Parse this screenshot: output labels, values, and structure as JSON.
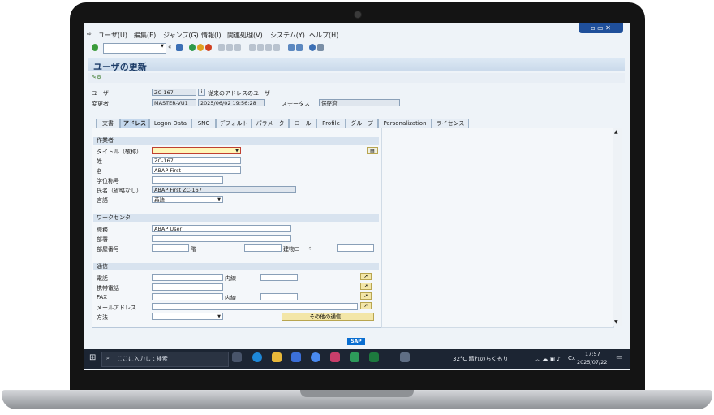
{
  "menu": [
    "ユーザ(U)",
    "編集(E)",
    "ジャンプ(G)",
    "情報(I)",
    "関連処理(V)",
    "システム(Y)",
    "ヘルプ(H)"
  ],
  "toolbar": {
    "command_value": "",
    "back_chevron": "«"
  },
  "title": "ユーザの更新",
  "header": {
    "user_label": "ユーザ",
    "user_value": "ZC-167",
    "user_desc": "従来のアドレスのユーザ",
    "changed_by_label": "変更者",
    "changed_by_value": "MASTER-VU1",
    "datetime_value": "2025/06/02 19:56:28",
    "status_label": "ステータス",
    "status_value": "保存済"
  },
  "tabs": [
    "文書",
    "アドレス",
    "Logon Data",
    "SNC",
    "デフォルト",
    "パラメータ",
    "ロール",
    "Profile",
    "グループ",
    "Personalization",
    "ライセンス"
  ],
  "active_tab": 1,
  "person": {
    "section": "作業者",
    "title_label": "タイトル（敬称）",
    "title_value": "",
    "last_name_label": "姓",
    "last_name_value": "ZC-167",
    "first_name_label": "名",
    "first_name_value": "ABAP First",
    "academic_label": "学位称号",
    "academic_value": "",
    "full_name_label": "氏名（省略なし）",
    "full_name_value": "ABAP First ZC-167",
    "language_label": "言語",
    "language_value": "英語"
  },
  "workcenter": {
    "section": "ワークセンタ",
    "function_label": "職務",
    "function_value": "ABAP User",
    "department_label": "部署",
    "department_value": "",
    "room_label": "部屋番号",
    "room_value": "",
    "floor_label": "階",
    "floor_value": "",
    "building_label": "建物コード",
    "building_value": ""
  },
  "comm": {
    "section": "通信",
    "phone_label": "電話",
    "ext_label": "内線",
    "mobile_label": "携帯電話",
    "fax_label": "FAX",
    "fax_ext_label": "内線",
    "email_label": "メールアドレス",
    "method_label": "方法",
    "method_value": "",
    "other_comm_button": "その他の通信..."
  },
  "status_bar": {
    "sap_logo": "SAP"
  },
  "taskbar": {
    "search_placeholder": "ここに入力して検索",
    "weather": "32°C  晴れのちくもり",
    "time": "17:57",
    "date": "2025/07/22",
    "ime": "Cx"
  },
  "colors": {
    "sap_blue": "#0a6ed1",
    "required_field": "#fff6b8",
    "taskbar": "#1c2533"
  }
}
